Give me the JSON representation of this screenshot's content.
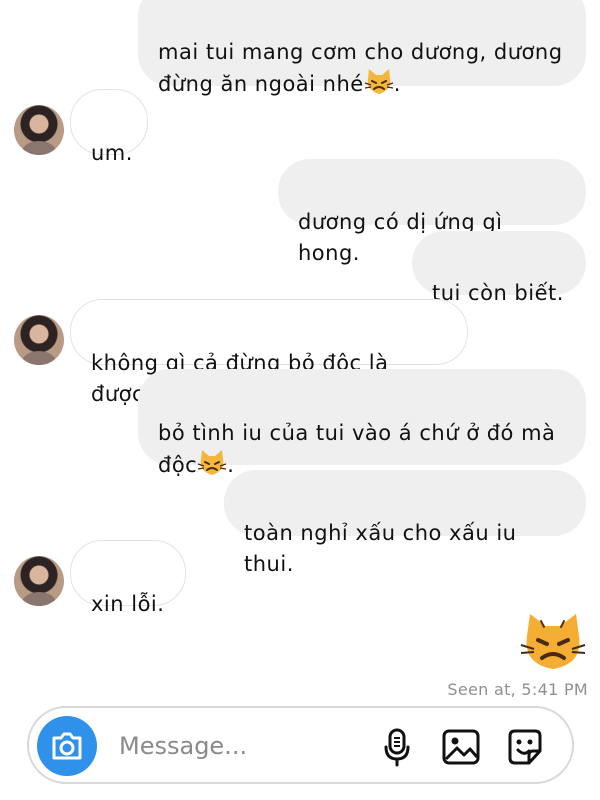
{
  "thread": {
    "messages": [
      {
        "sender": "me",
        "text": "mai tui mang cơm cho dương, dương\nđừng ăn ngoài nhé",
        "suffix": "."
      },
      {
        "sender": "them",
        "text": "um."
      },
      {
        "sender": "me",
        "text": "dương có dị ứng gì hong."
      },
      {
        "sender": "me",
        "text": "tui còn biết."
      },
      {
        "sender": "them",
        "text": "không gì cả đừng bỏ độc là được."
      },
      {
        "sender": "me",
        "text": "bỏ tình iu của tui vào á chứ ở đó mà\nđộc",
        "suffix": "."
      },
      {
        "sender": "me",
        "text": "toàn nghỉ xấu cho xấu iu thui."
      },
      {
        "sender": "them",
        "text": "xin lỗi."
      }
    ],
    "sticker": "pouting-cat-emoji",
    "seen_status": "Seen at, 5:41 PM"
  },
  "composer": {
    "placeholder": "Message...",
    "value": "",
    "icons": [
      "camera-icon",
      "microphone-icon",
      "image-icon",
      "sticker-icon"
    ],
    "camera_color": "#2f91ea"
  },
  "colors": {
    "outgoing_bubble": "#efefef",
    "incoming_bubble": "#ffffff",
    "seen_text": "#909090"
  }
}
